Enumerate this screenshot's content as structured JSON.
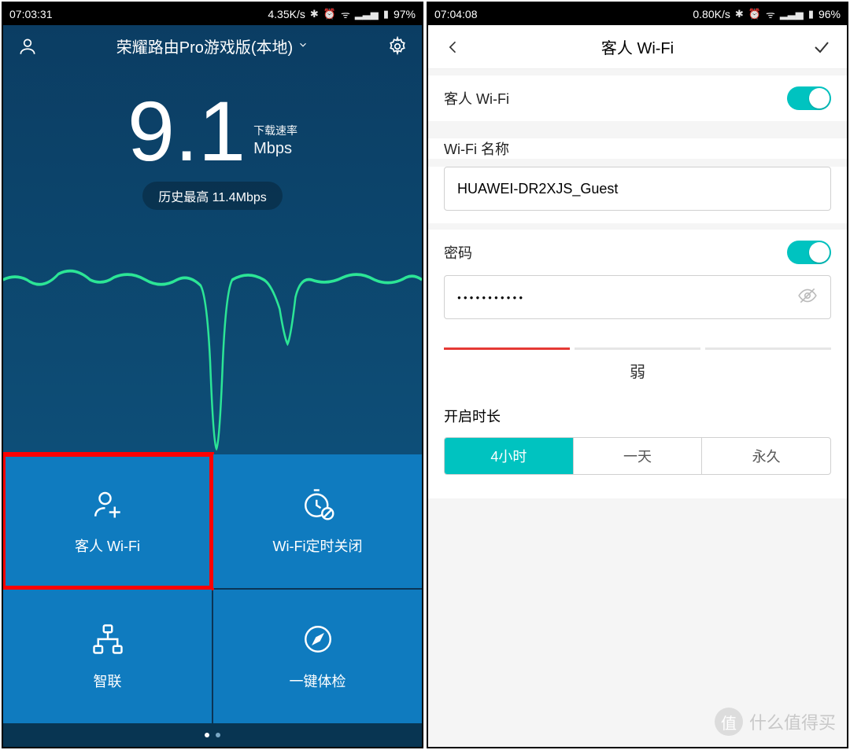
{
  "left": {
    "status_time": "07:03:31",
    "status_rate": "4.35K/s",
    "status_battery": "97%",
    "header_title": "荣耀路由Pro游戏版(本地)",
    "speed_value": "9.1",
    "speed_label": "下载速率",
    "speed_unit": "Mbps",
    "history": "历史最高 11.4Mbps",
    "tiles": [
      {
        "label": "客人 Wi-Fi"
      },
      {
        "label": "Wi-Fi定时关闭"
      },
      {
        "label": "智联"
      },
      {
        "label": "一键体检"
      }
    ]
  },
  "right": {
    "status_time": "07:04:08",
    "status_rate": "0.80K/s",
    "status_battery": "96%",
    "page_title": "客人 Wi-Fi",
    "guest_toggle_label": "客人 Wi-Fi",
    "ssid_label": "Wi-Fi 名称",
    "ssid_value": "HUAWEI-DR2XJS_Guest",
    "password_label": "密码",
    "password_masked": "●●●●●●●●●●●",
    "strength_label": "弱",
    "duration_label": "开启时长",
    "duration_options": [
      "4小时",
      "一天",
      "永久"
    ],
    "duration_selected": 0
  },
  "watermark": {
    "logo_char": "值",
    "text": "什么值得买"
  }
}
